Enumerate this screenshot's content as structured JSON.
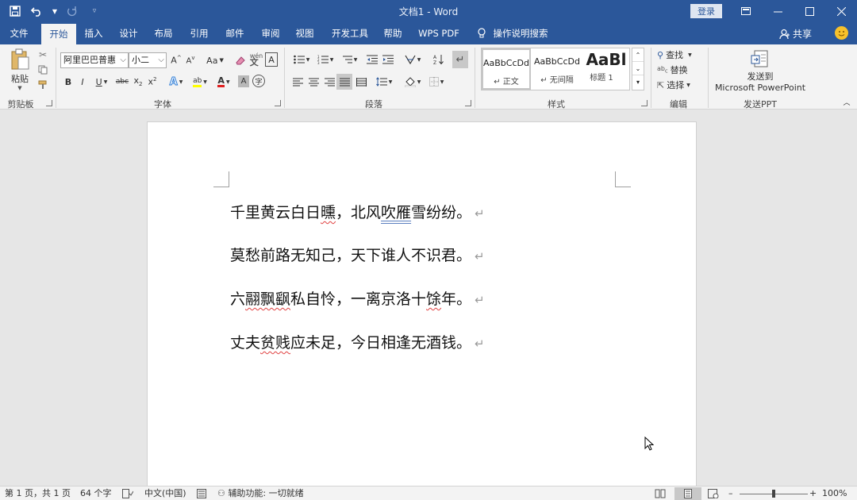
{
  "window": {
    "title": "文档1 - Word",
    "login_label": "登录"
  },
  "tabs": [
    {
      "label": "文件"
    },
    {
      "label": "开始"
    },
    {
      "label": "插入"
    },
    {
      "label": "设计"
    },
    {
      "label": "布局"
    },
    {
      "label": "引用"
    },
    {
      "label": "邮件"
    },
    {
      "label": "审阅"
    },
    {
      "label": "视图"
    },
    {
      "label": "开发工具"
    },
    {
      "label": "帮助"
    },
    {
      "label": "WPS PDF"
    },
    {
      "label": "操作说明搜索"
    }
  ],
  "share_label": "共享",
  "ribbon": {
    "clipboard": {
      "paste_label": "粘贴",
      "group_label": "剪贴板"
    },
    "font": {
      "font_name": "阿里巴巴普惠",
      "font_size": "小二",
      "case_label": "Aa",
      "group_label": "字体"
    },
    "paragraph": {
      "group_label": "段落"
    },
    "styles": {
      "items": [
        {
          "sample": "AaBbCcDd",
          "name": "正文"
        },
        {
          "sample": "AaBbCcDd",
          "name": "无间隔"
        },
        {
          "sample": "AaBl",
          "name": "标题 1"
        }
      ],
      "group_label": "样式"
    },
    "editing": {
      "find_label": "查找",
      "replace_label": "替换",
      "select_label": "选择",
      "group_label": "编辑"
    },
    "sendppt": {
      "line1": "发送到",
      "line2": "Microsoft PowerPoint",
      "group_label": "发送PPT"
    }
  },
  "document": {
    "paragraphs": [
      {
        "a": "千里黄云白日",
        "b": "曛",
        "c": "，北风",
        "d": "吹雁",
        "e": "雪纷纷。"
      },
      {
        "a": "莫愁前路无知己，天下谁人不识君。",
        "b": "",
        "c": "",
        "d": "",
        "e": ""
      },
      {
        "a": "六",
        "b": "翮飘飖",
        "c": "私自怜，一离京洛十",
        "d": "馀",
        "e": "年。"
      },
      {
        "a": "丈夫",
        "b": "贫贱",
        "c": "应未足，今日相逢无酒钱。",
        "d": "",
        "e": ""
      }
    ],
    "para_mark": "↵"
  },
  "status": {
    "page": "第 1 页，共 1 页",
    "words": "64 个字",
    "language": "中文(中国)",
    "accessibility": "辅助功能: 一切就绪",
    "zoom": "100%",
    "zoom_level": 1.0
  }
}
